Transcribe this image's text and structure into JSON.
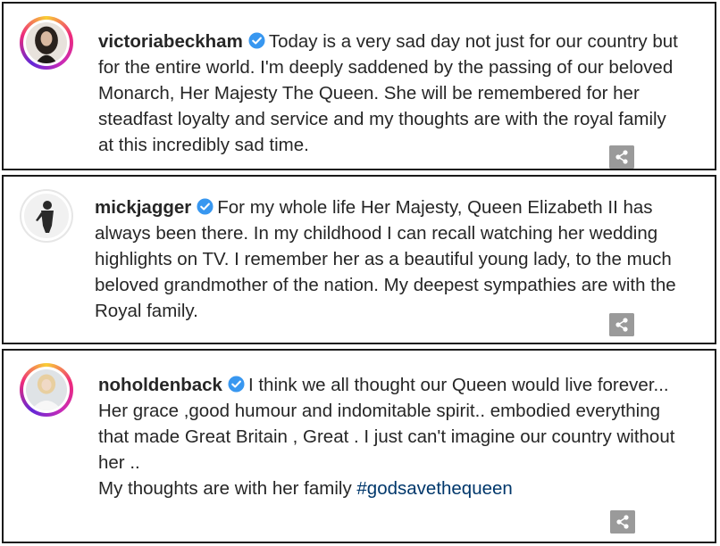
{
  "posts": [
    {
      "username": "victoriabeckham",
      "verified_icon": "verified-badge-icon",
      "avatar_icon": "profile-avatar",
      "has_story_ring": true,
      "caption": "Today is a very sad day not just for our country but for the entire world. I'm deeply saddened by the passing of our beloved Monarch, Her Majesty The Queen. She will be remembered for her steadfast loyalty and service and my thoughts are with the royal family at this incredibly sad time."
    },
    {
      "username": "mickjagger",
      "verified_icon": "verified-badge-icon",
      "avatar_icon": "profile-avatar",
      "has_story_ring": false,
      "caption": "For my whole life Her Majesty, Queen Elizabeth II has always been there. In my childhood I can recall watching her wedding highlights on TV. I remember her as a beautiful young lady, to the much beloved grandmother of the nation. My deepest sympathies are with the Royal family."
    },
    {
      "username": "noholdenback",
      "verified_icon": "verified-badge-icon",
      "avatar_icon": "profile-avatar",
      "has_story_ring": true,
      "caption": "I think we all thought our Queen would live forever...\nHer grace ,good humour and indomitable spirit.. embodied everything that made Great Britain , Great . I just can't imagine our country without her ..\nMy thoughts are with her family ",
      "hashtag": "#godsavethequeen"
    }
  ],
  "colors": {
    "text": "#262626",
    "verified_blue": "#3897f0",
    "hashtag": "#00376b",
    "share_icon_bg": "#9a9a9a",
    "border": "#1a1a1a"
  },
  "share_icon": "share-icon"
}
